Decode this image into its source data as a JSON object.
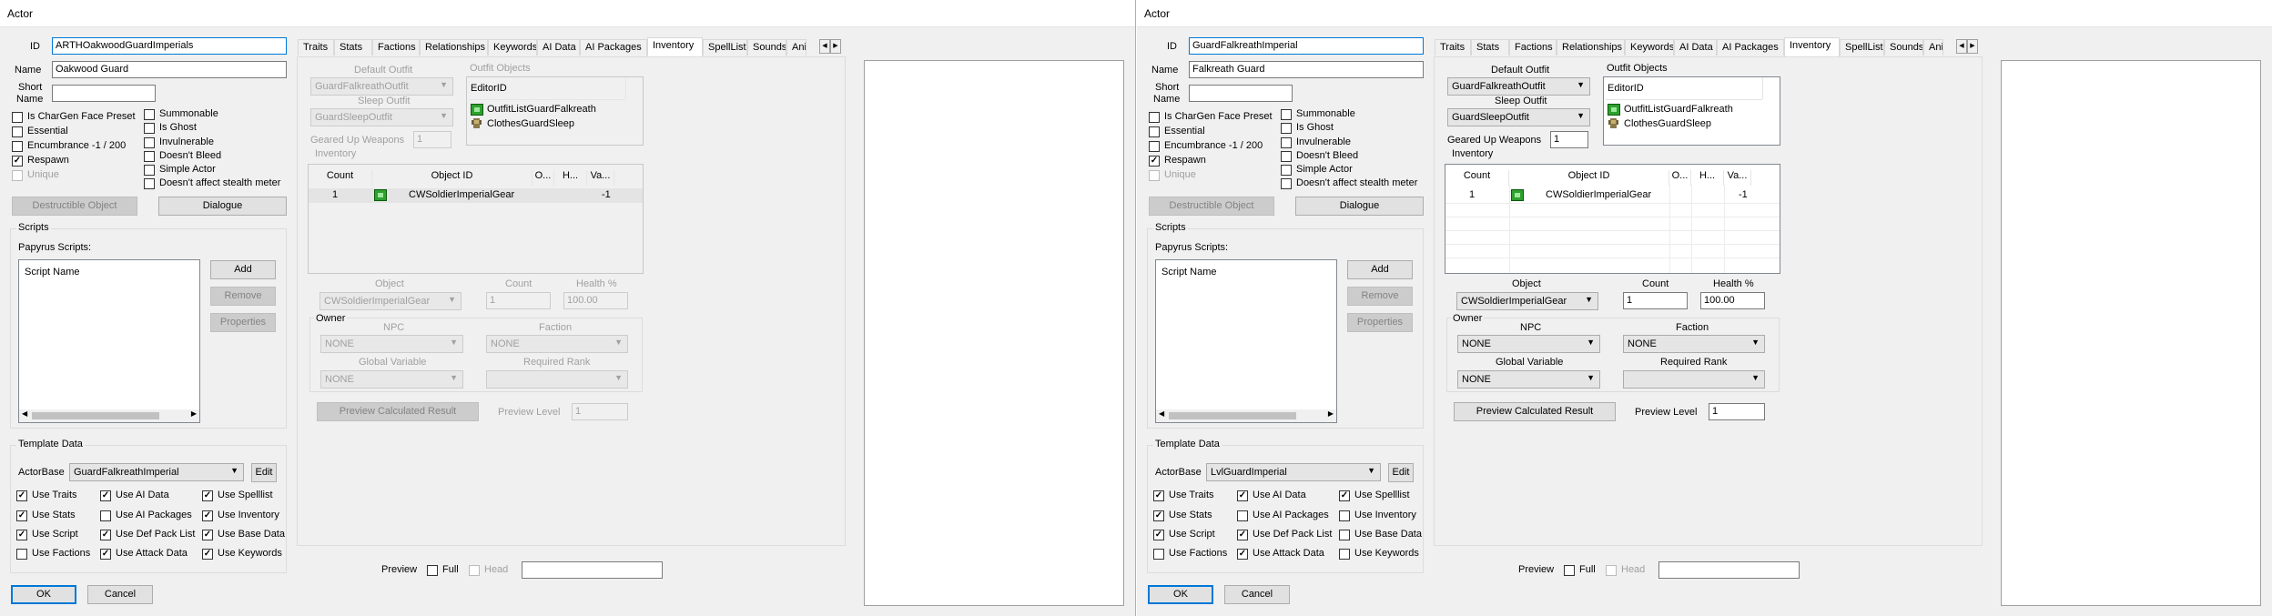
{
  "windows": [
    {
      "title": "Actor",
      "id_label": "ID",
      "id_value": "ARTHOakwoodGuardImperials",
      "name_label": "Name",
      "name_value": "Oakwood Guard",
      "short_name_label1": "Short",
      "short_name_label2": "Name",
      "short_name_value": "",
      "flags_left": [
        {
          "label": "Is CharGen Face Preset",
          "checked": false,
          "disabled": false
        },
        {
          "label": "Essential",
          "checked": false,
          "disabled": false
        },
        {
          "label": "Encumbrance -1 / 200",
          "checked": false,
          "disabled": false
        },
        {
          "label": "Respawn",
          "checked": true,
          "disabled": false
        },
        {
          "label": "Unique",
          "checked": false,
          "disabled": true
        }
      ],
      "flags_right": [
        {
          "label": "Summonable",
          "checked": false
        },
        {
          "label": "Is Ghost",
          "checked": false
        },
        {
          "label": "Invulnerable",
          "checked": false
        },
        {
          "label": "Doesn't Bleed",
          "checked": false
        },
        {
          "label": "Simple Actor",
          "checked": false
        },
        {
          "label": "Doesn't affect stealth meter",
          "checked": false
        }
      ],
      "destructible_label": "Destructible Object",
      "dialogue_label": "Dialogue",
      "scripts_label": "Scripts",
      "papyrus_label": "Papyrus Scripts:",
      "script_name_header": "Script Name",
      "add_label": "Add",
      "remove_label": "Remove",
      "properties_label": "Properties",
      "template_label": "Template Data",
      "actorbase_label": "ActorBase",
      "actorbase_value": "GuardFalkreathImperial",
      "edit_label": "Edit",
      "template_checks": [
        {
          "label": "Use Traits",
          "checked": true
        },
        {
          "label": "Use AI Data",
          "checked": true
        },
        {
          "label": "Use Spelllist",
          "checked": true
        },
        {
          "label": "Use Stats",
          "checked": true
        },
        {
          "label": "Use AI Packages",
          "checked": false
        },
        {
          "label": "Use Inventory",
          "checked": true
        },
        {
          "label": "Use Script",
          "checked": true
        },
        {
          "label": "Use Def Pack List",
          "checked": true
        },
        {
          "label": "Use Base Data",
          "checked": true
        },
        {
          "label": "Use Factions",
          "checked": false
        },
        {
          "label": "Use Attack Data",
          "checked": true
        },
        {
          "label": "Use Keywords",
          "checked": true
        }
      ],
      "ok_label": "OK",
      "cancel_label": "Cancel",
      "tabs": [
        "Traits",
        "Stats",
        "Factions",
        "Relationships",
        "Keywords",
        "AI Data",
        "AI Packages",
        "Inventory",
        "SpellList",
        "Sounds",
        "Anim"
      ],
      "selected_tab": "Inventory",
      "inventory_disabled": true,
      "default_outfit_label": "Default Outfit",
      "default_outfit_value": "GuardFalkreathOutfit",
      "sleep_outfit_label": "Sleep Outfit",
      "sleep_outfit_value": "GuardSleepOutfit",
      "geared_label": "Geared Up Weapons",
      "geared_value": "1",
      "inventory_label": "Inventory",
      "outfit_objects_label": "Outfit Objects",
      "editor_id_header": "EditorID",
      "outfit_items": [
        {
          "icon": "outfit-list-icon",
          "name": "OutfitListGuardFalkreath"
        },
        {
          "icon": "armor-icon",
          "name": "ClothesGuardSleep"
        }
      ],
      "inv_headers": [
        "Count",
        "Object ID",
        "O...",
        "H...",
        "Va..."
      ],
      "inv_rows": [
        {
          "count": "1",
          "object": "CWSoldierImperialGear",
          "o": "",
          "h": "",
          "va": "-1"
        }
      ],
      "object_label": "Object",
      "object_value": "CWSoldierImperialGear",
      "count_label": "Count",
      "count_value": "1",
      "health_label": "Health %",
      "health_value": "100.00",
      "owner_label": "Owner",
      "npc_label": "NPC",
      "npc_value": "NONE",
      "faction_label": "Faction",
      "faction_value": "NONE",
      "global_label": "Global Variable",
      "global_value": "NONE",
      "rank_label": "Required Rank",
      "rank_value": "",
      "preview_calc_label": "Preview Calculated Result",
      "preview_level_label": "Preview Level",
      "preview_level_value": "1",
      "preview_label": "Preview",
      "full_label": "Full",
      "head_label": "Head"
    },
    {
      "title": "Actor",
      "id_label": "ID",
      "id_value": "GuardFalkreathImperial",
      "name_label": "Name",
      "name_value": "Falkreath Guard",
      "short_name_label1": "Short",
      "short_name_label2": "Name",
      "short_name_value": "",
      "flags_left": [
        {
          "label": "Is CharGen Face Preset",
          "checked": false,
          "disabled": false
        },
        {
          "label": "Essential",
          "checked": false,
          "disabled": false
        },
        {
          "label": "Encumbrance -1 / 200",
          "checked": false,
          "disabled": false
        },
        {
          "label": "Respawn",
          "checked": true,
          "disabled": false
        },
        {
          "label": "Unique",
          "checked": false,
          "disabled": true
        }
      ],
      "flags_right": [
        {
          "label": "Summonable",
          "checked": false
        },
        {
          "label": "Is Ghost",
          "checked": false
        },
        {
          "label": "Invulnerable",
          "checked": false
        },
        {
          "label": "Doesn't Bleed",
          "checked": false
        },
        {
          "label": "Simple Actor",
          "checked": false
        },
        {
          "label": "Doesn't affect stealth meter",
          "checked": false
        }
      ],
      "destructible_label": "Destructible Object",
      "dialogue_label": "Dialogue",
      "scripts_label": "Scripts",
      "papyrus_label": "Papyrus Scripts:",
      "script_name_header": "Script Name",
      "add_label": "Add",
      "remove_label": "Remove",
      "properties_label": "Properties",
      "template_label": "Template Data",
      "actorbase_label": "ActorBase",
      "actorbase_value": "LvlGuardImperial",
      "edit_label": "Edit",
      "template_checks": [
        {
          "label": "Use Traits",
          "checked": true
        },
        {
          "label": "Use AI Data",
          "checked": true
        },
        {
          "label": "Use Spelllist",
          "checked": true
        },
        {
          "label": "Use Stats",
          "checked": true
        },
        {
          "label": "Use AI Packages",
          "checked": false
        },
        {
          "label": "Use Inventory",
          "checked": false
        },
        {
          "label": "Use Script",
          "checked": true
        },
        {
          "label": "Use Def Pack List",
          "checked": true
        },
        {
          "label": "Use Base Data",
          "checked": false
        },
        {
          "label": "Use Factions",
          "checked": false
        },
        {
          "label": "Use Attack Data",
          "checked": true
        },
        {
          "label": "Use Keywords",
          "checked": false
        }
      ],
      "ok_label": "OK",
      "cancel_label": "Cancel",
      "tabs": [
        "Traits",
        "Stats",
        "Factions",
        "Relationships",
        "Keywords",
        "AI Data",
        "AI Packages",
        "Inventory",
        "SpellList",
        "Sounds",
        "Anim"
      ],
      "selected_tab": "Inventory",
      "inventory_disabled": false,
      "default_outfit_label": "Default Outfit",
      "default_outfit_value": "GuardFalkreathOutfit",
      "sleep_outfit_label": "Sleep Outfit",
      "sleep_outfit_value": "GuardSleepOutfit",
      "geared_label": "Geared Up Weapons",
      "geared_value": "1",
      "inventory_label": "Inventory",
      "outfit_objects_label": "Outfit Objects",
      "editor_id_header": "EditorID",
      "outfit_items": [
        {
          "icon": "outfit-list-icon",
          "name": "OutfitListGuardFalkreath"
        },
        {
          "icon": "armor-icon",
          "name": "ClothesGuardSleep"
        }
      ],
      "inv_headers": [
        "Count",
        "Object ID",
        "O...",
        "H...",
        "Va..."
      ],
      "inv_rows": [
        {
          "count": "1",
          "object": "CWSoldierImperialGear",
          "o": "",
          "h": "",
          "va": "-1"
        }
      ],
      "object_label": "Object",
      "object_value": "CWSoldierImperialGear",
      "count_label": "Count",
      "count_value": "1",
      "health_label": "Health %",
      "health_value": "100.00",
      "owner_label": "Owner",
      "npc_label": "NPC",
      "npc_value": "NONE",
      "faction_label": "Faction",
      "faction_value": "NONE",
      "global_label": "Global Variable",
      "global_value": "NONE",
      "rank_label": "Required Rank",
      "rank_value": "",
      "preview_calc_label": "Preview Calculated Result",
      "preview_level_label": "Preview Level",
      "preview_level_value": "1",
      "preview_label": "Preview",
      "full_label": "Full",
      "head_label": "Head"
    }
  ]
}
